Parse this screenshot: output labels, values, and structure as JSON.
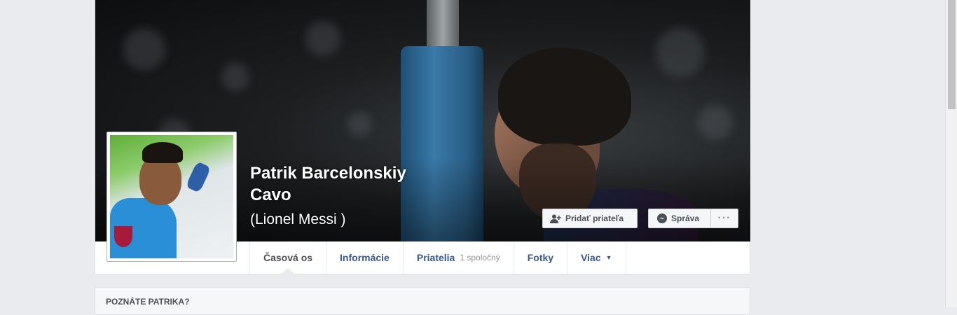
{
  "profile": {
    "name_line1": "Patrik Barcelonskiy",
    "name_line2": "Cavo",
    "alternate_name": "(Lionel Messi )"
  },
  "actions": {
    "add_friend_label": "Pridať priateľa",
    "message_label": "Správa",
    "more_label": "···"
  },
  "tabs": [
    {
      "label": "Časová os",
      "active": true
    },
    {
      "label": "Informácie"
    },
    {
      "label": "Priatelia",
      "sub": "1 spoločný"
    },
    {
      "label": "Fotky"
    },
    {
      "label": "Viac",
      "caret": "▼"
    }
  ],
  "know_section": {
    "title": "POZNÁTE PATRIKA?"
  },
  "icons": {
    "add_friend": "add-friend-icon",
    "messenger": "messenger-icon",
    "dropdown": "caret-down-icon"
  },
  "colors": {
    "link": "#365899",
    "background": "#e9ebee",
    "button_bg": "#f5f6f7"
  }
}
